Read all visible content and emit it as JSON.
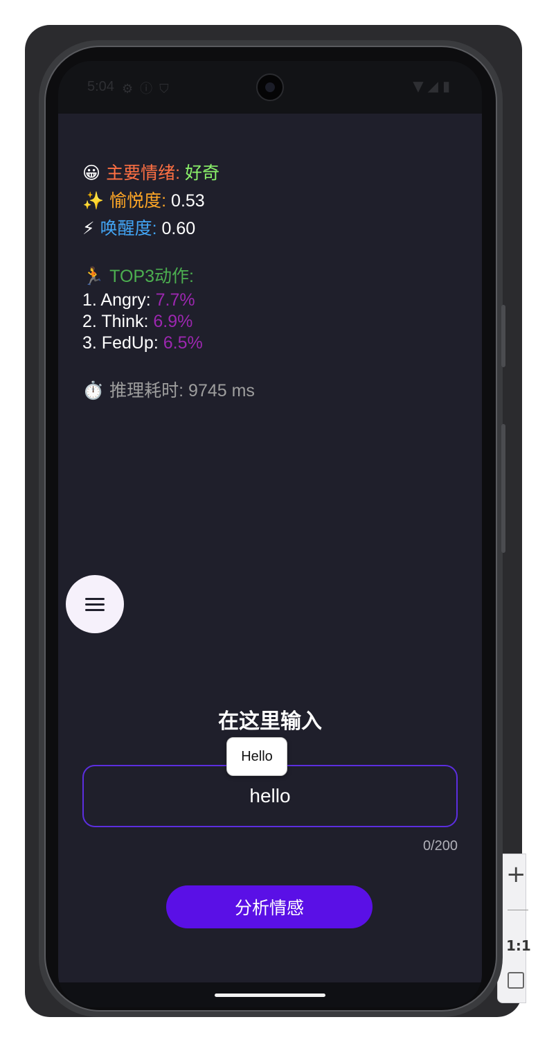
{
  "status_bar": {
    "time": "5:04",
    "left_icons": [
      "settings-icon",
      "info-icon",
      "shield-icon"
    ],
    "right_icons": [
      "wifi-icon",
      "signal-icon",
      "battery-icon"
    ]
  },
  "results": {
    "emotion": {
      "emoji": "😀",
      "label": "主要情绪:",
      "value": "好奇"
    },
    "valence": {
      "emoji": "✨",
      "label": "愉悦度:",
      "value": "0.53"
    },
    "arousal": {
      "emoji": "⚡",
      "label": "唤醒度:",
      "value": "0.60"
    },
    "top_actions": {
      "emoji": "🏃",
      "label": "TOP3动作:",
      "items": [
        {
          "prefix": "1. Angry:",
          "pct": "7.7%"
        },
        {
          "prefix": "2. Think:",
          "pct": "6.9%"
        },
        {
          "prefix": "3. FedUp:",
          "pct": "6.5%"
        }
      ]
    },
    "timing": {
      "emoji": "⏱️",
      "label": "推理耗时:",
      "value": "9745 ms"
    }
  },
  "input": {
    "title": "在这里输入",
    "value": "hello",
    "counter": "0/200",
    "suggestion": "Hello"
  },
  "analyze_button": {
    "label": "分析情感"
  },
  "emulator": {
    "zoom_ratio": "1:1"
  },
  "colors": {
    "app_background": "#1f1f2b",
    "accent": "#5a10e6",
    "emotion_label": "#ff7043",
    "emotion_value": "#8bf36a",
    "valence_label": "#ffa726",
    "arousal_label": "#42a5f5",
    "actions_label": "#4caf50",
    "percent": "#9c27b0",
    "muted": "#9e9e9e"
  }
}
